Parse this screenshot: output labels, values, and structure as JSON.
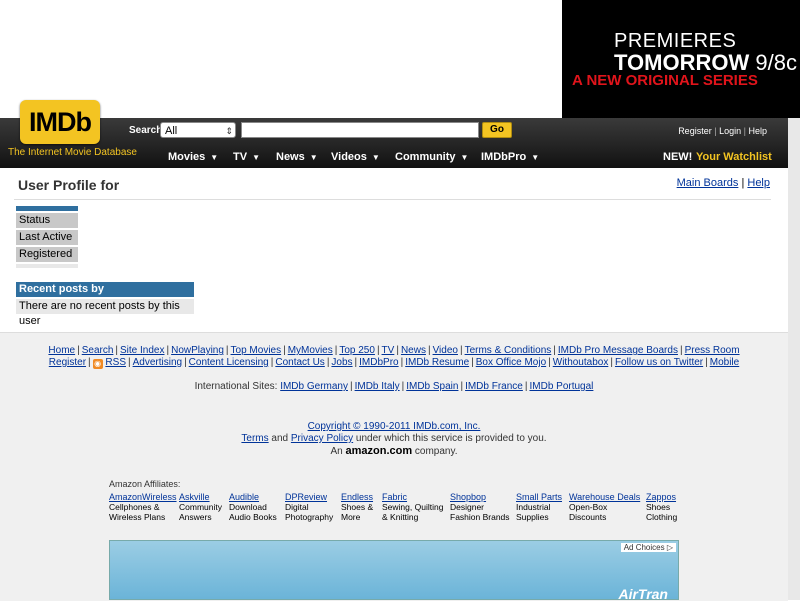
{
  "ad_top": {
    "line1": "PREMIERES",
    "line2_bold": "TOMORROW",
    "line2_time": "9/8c",
    "line3": "A NEW ORIGINAL SERIES"
  },
  "header": {
    "logo": "IMDb",
    "tagline": "The Internet Movie Database",
    "search_label": "Search",
    "search_select_value": "All",
    "go_label": "Go",
    "util_links": [
      "Register",
      "Login",
      "Help"
    ],
    "nav": [
      "Movies",
      "TV",
      "News",
      "Videos",
      "Community",
      "IMDbPro"
    ],
    "new_label": "NEW!",
    "watchlist_label": "Your Watchlist"
  },
  "main": {
    "title": "User Profile for",
    "board_links": [
      "Main Boards",
      "Help"
    ],
    "status_rows": [
      "Status",
      "Last Active",
      "Registered"
    ],
    "recent_header": "Recent posts by",
    "recent_empty": "There are no recent posts by this user"
  },
  "footer": {
    "links_row1": [
      "Home",
      "Search",
      "Site Index",
      "NowPlaying",
      "Top Movies",
      "MyMovies",
      "Top 250",
      "TV",
      "News",
      "Video",
      "Terms & Conditions",
      "IMDb Pro Message Boards",
      "Press Room"
    ],
    "links_row2": [
      "Register",
      "RSS",
      "Advertising",
      "Content Licensing",
      "Contact Us",
      "Jobs",
      "IMDbPro",
      "IMDb Resume",
      "Box Office Mojo",
      "Withoutabox",
      "Follow us on Twitter",
      "Mobile"
    ],
    "intl_label": "International Sites:",
    "intl_links": [
      "IMDb Germany",
      "IMDb Italy",
      "IMDb Spain",
      "IMDb France",
      "IMDb Portugal"
    ],
    "copyright": "Copyright © 1990-2011 IMDb.com, Inc.",
    "terms": "Terms",
    "and": "and",
    "privacy": "Privacy Policy",
    "terms_tail": "under which this service is provided to you.",
    "an": "An",
    "amazon": "amazon.com",
    "company": "company.",
    "affiliates_title": "Amazon Affiliates:",
    "affiliates": [
      {
        "name": "AmazonWireless",
        "desc1": "Cellphones &",
        "desc2": "Wireless Plans"
      },
      {
        "name": "Askville",
        "desc1": "Community",
        "desc2": "Answers"
      },
      {
        "name": "Audible",
        "desc1": "Download",
        "desc2": "Audio Books"
      },
      {
        "name": "DPReview",
        "desc1": "Digital",
        "desc2": "Photography"
      },
      {
        "name": "Endless",
        "desc1": "Shoes &",
        "desc2": "More"
      },
      {
        "name": "Fabric",
        "desc1": "Sewing, Quilting",
        "desc2": "& Knitting"
      },
      {
        "name": "Shopbop",
        "desc1": "Designer",
        "desc2": "Fashion Brands"
      },
      {
        "name": "Small Parts",
        "desc1": "Industrial",
        "desc2": "Supplies"
      },
      {
        "name": "Warehouse Deals",
        "desc1": "Open-Box",
        "desc2": "Discounts"
      },
      {
        "name": "Zappos",
        "desc1": "Shoes",
        "desc2": "Clothing"
      }
    ],
    "ad_choices": "Ad Choices",
    "ad_brand": "AirTran"
  }
}
